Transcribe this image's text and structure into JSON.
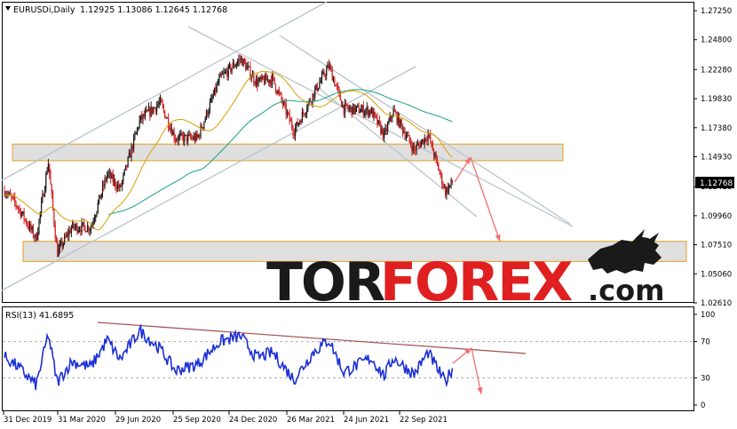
{
  "header": {
    "symbol": "EURUSDi,Daily",
    "ohlc": "1.12925 1.13086 1.12645 1.12768"
  },
  "rsi_header": "RSI(13) 41.6895",
  "watermark": {
    "part1": "TOR",
    "part2": "FOREX",
    "part3": ".com"
  },
  "colors": {
    "bull": "#1a1a1a",
    "bear": "#d42020",
    "ma_fast": "#d9a000",
    "ma_slow": "#16a085",
    "rsi": "#1a2fd6",
    "zone_fill": "#d9d9d9",
    "zone_border": "#e0a020",
    "channel": "#b8c4cc",
    "arrow": "#f07070",
    "rsi_trend": "#a05050",
    "brand_red": "#e02020",
    "brand_dark": "#1a1a1a"
  },
  "chart_data": [
    {
      "type": "candlestick",
      "title": "EURUSDi,Daily",
      "y_ticks": [
        "1.27250",
        "1.24800",
        "1.22280",
        "1.19830",
        "1.17380",
        "1.14930",
        "1.12410",
        "1.09960",
        "1.07510",
        "1.05060",
        "1.02610"
      ],
      "ylim": [
        1.0261,
        1.2725
      ],
      "current_price": "1.12768",
      "x_ticks": [
        "31 Dec 2019",
        "31 Mar 2020",
        "29 Jun 2020",
        "25 Sep 2020",
        "24 Dec 2020",
        "26 Mar 2021",
        "24 Jun 2021",
        "22 Sep 2021"
      ],
      "price_path": [
        {
          "date": "31 Dec 2019",
          "close": 1.121
        },
        {
          "date": "20 Jan 2020",
          "close": 1.108
        },
        {
          "date": "19 Feb 2020",
          "close": 1.08
        },
        {
          "date": "09 Mar 2020",
          "close": 1.145
        },
        {
          "date": "23 Mar 2020",
          "close": 1.068
        },
        {
          "date": "15 Apr 2020",
          "close": 1.09
        },
        {
          "date": "15 May 2020",
          "close": 1.09
        },
        {
          "date": "10 Jun 2020",
          "close": 1.135
        },
        {
          "date": "30 Jun 2020",
          "close": 1.122
        },
        {
          "date": "31 Jul 2020",
          "close": 1.18
        },
        {
          "date": "01 Sep 2020",
          "close": 1.195
        },
        {
          "date": "25 Sep 2020",
          "close": 1.165
        },
        {
          "date": "30 Oct 2020",
          "close": 1.165
        },
        {
          "date": "04 Dec 2020",
          "close": 1.215
        },
        {
          "date": "06 Jan 2021",
          "close": 1.232
        },
        {
          "date": "31 Jan 2021",
          "close": 1.212
        },
        {
          "date": "25 Feb 2021",
          "close": 1.215
        },
        {
          "date": "31 Mar 2021",
          "close": 1.171
        },
        {
          "date": "30 Apr 2021",
          "close": 1.202
        },
        {
          "date": "25 May 2021",
          "close": 1.226
        },
        {
          "date": "17 Jun 2021",
          "close": 1.19
        },
        {
          "date": "30 Jul 2021",
          "close": 1.188
        },
        {
          "date": "20 Aug 2021",
          "close": 1.167
        },
        {
          "date": "03 Sep 2021",
          "close": 1.188
        },
        {
          "date": "06 Oct 2021",
          "close": 1.155
        },
        {
          "date": "28 Oct 2021",
          "close": 1.168
        },
        {
          "date": "24 Nov 2021",
          "close": 1.12
        },
        {
          "date": "06 Dec 2021",
          "close": 1.128
        }
      ],
      "support_resistance_zones": [
        [
          1.146,
          1.16
        ],
        [
          1.061,
          1.078
        ]
      ],
      "forecast_path": [
        1.128,
        1.149,
        1.078
      ]
    },
    {
      "type": "line",
      "title": "RSI(13) 41.6895",
      "y_ticks": [
        "100",
        "70",
        "30",
        "0"
      ],
      "ylim": [
        0,
        100
      ],
      "levels": [
        70,
        30
      ],
      "last_value": 41.6895,
      "rsi_path": [
        {
          "date": "31 Dec 2019",
          "value": 53
        },
        {
          "date": "20 Jan 2020",
          "value": 43
        },
        {
          "date": "19 Feb 2020",
          "value": 22
        },
        {
          "date": "09 Mar 2020",
          "value": 78
        },
        {
          "date": "23 Mar 2020",
          "value": 25
        },
        {
          "date": "15 Apr 2020",
          "value": 48
        },
        {
          "date": "15 May 2020",
          "value": 42
        },
        {
          "date": "10 Jun 2020",
          "value": 72
        },
        {
          "date": "30 Jun 2020",
          "value": 50
        },
        {
          "date": "31 Jul 2020",
          "value": 82
        },
        {
          "date": "01 Sep 2020",
          "value": 62
        },
        {
          "date": "25 Sep 2020",
          "value": 38
        },
        {
          "date": "30 Oct 2020",
          "value": 45
        },
        {
          "date": "04 Dec 2020",
          "value": 70
        },
        {
          "date": "06 Jan 2021",
          "value": 76
        },
        {
          "date": "31 Jan 2021",
          "value": 52
        },
        {
          "date": "25 Feb 2021",
          "value": 58
        },
        {
          "date": "31 Mar 2021",
          "value": 28
        },
        {
          "date": "30 Apr 2021",
          "value": 58
        },
        {
          "date": "25 May 2021",
          "value": 72
        },
        {
          "date": "17 Jun 2021",
          "value": 36
        },
        {
          "date": "30 Jul 2021",
          "value": 52
        },
        {
          "date": "20 Aug 2021",
          "value": 32
        },
        {
          "date": "03 Sep 2021",
          "value": 52
        },
        {
          "date": "06 Oct 2021",
          "value": 34
        },
        {
          "date": "28 Oct 2021",
          "value": 58
        },
        {
          "date": "24 Nov 2021",
          "value": 25
        },
        {
          "date": "06 Dec 2021",
          "value": 42
        }
      ],
      "forecast_path": [
        46,
        63,
        12
      ]
    }
  ]
}
